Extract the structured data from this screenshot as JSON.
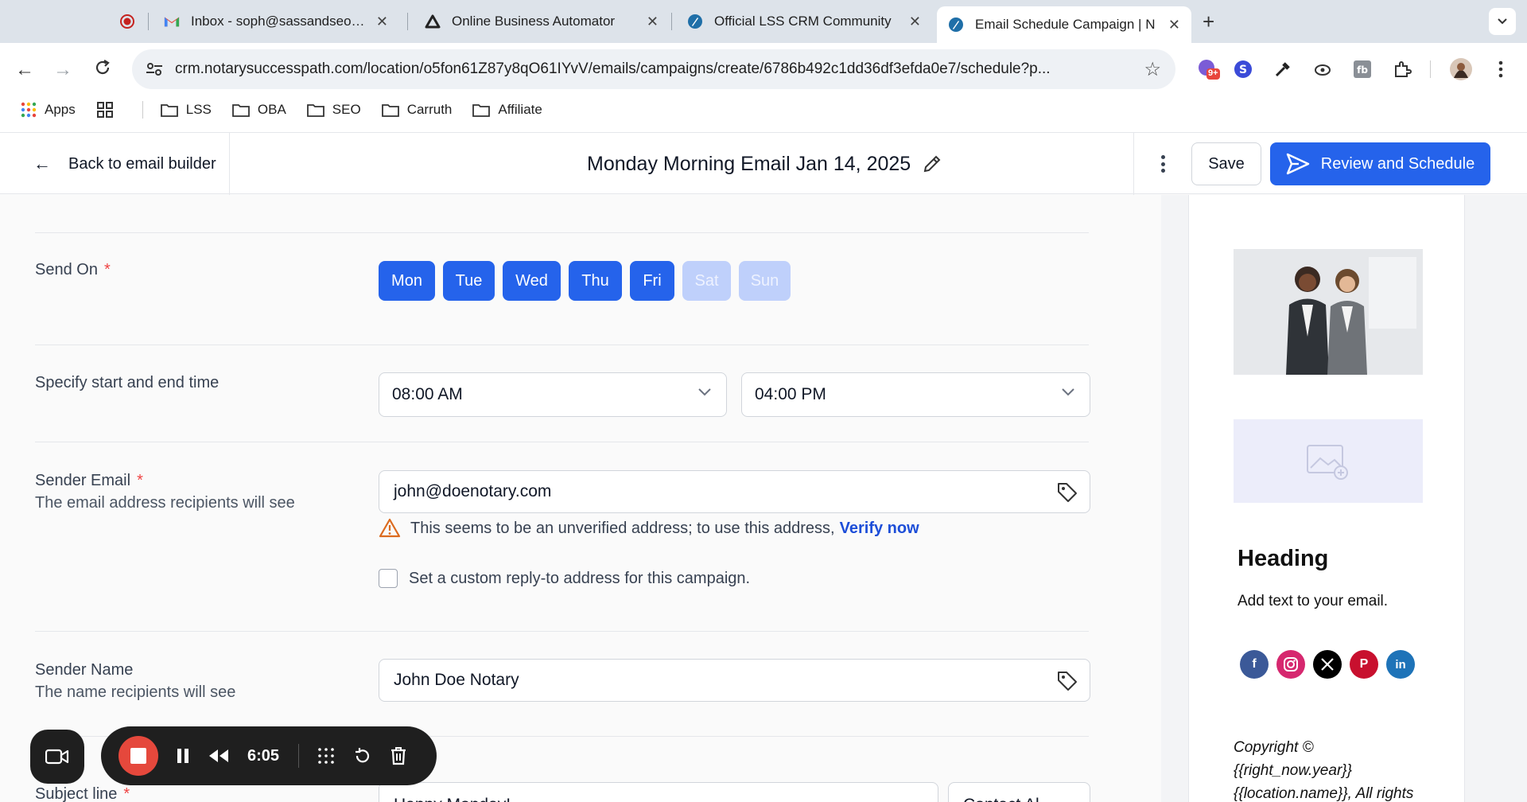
{
  "browser": {
    "tabs": [
      {
        "title": "",
        "icon": "record-icon"
      },
      {
        "title": "Inbox - soph@sassandseo.com",
        "icon": "gmail-icon"
      },
      {
        "title": "Online Business Automator",
        "icon": "triangle-logo-icon"
      },
      {
        "title": "Official LSS CRM Community",
        "icon": "compass-icon"
      },
      {
        "title": "Email Schedule Campaign | N",
        "icon": "compass-icon",
        "active": true
      }
    ],
    "url": "crm.notarysuccesspath.com/location/o5fon61Z87y8qO61IYvV/emails/campaigns/create/6786b492c1dd36df3efda0e7/schedule?p...",
    "extension_badge": "9+",
    "bookmarks": [
      "Apps",
      "LSS",
      "OBA",
      "SEO",
      "Carruth",
      "Affiliate"
    ]
  },
  "header": {
    "back_label": "Back to email builder",
    "title": "Monday Morning Email Jan 14, 2025",
    "save_label": "Save",
    "review_label": "Review and Schedule"
  },
  "form": {
    "send_on": {
      "label": "Send On",
      "required": "*",
      "days": [
        {
          "label": "Mon",
          "selected": true
        },
        {
          "label": "Tue",
          "selected": true
        },
        {
          "label": "Wed",
          "selected": true
        },
        {
          "label": "Thu",
          "selected": true
        },
        {
          "label": "Fri",
          "selected": true
        },
        {
          "label": "Sat",
          "selected": false
        },
        {
          "label": "Sun",
          "selected": false
        }
      ]
    },
    "time": {
      "label": "Specify start and end time",
      "start": "08:00 AM",
      "end": "04:00 PM"
    },
    "sender_email": {
      "label": "Sender Email",
      "required": "*",
      "sublabel": "The email address recipients will see",
      "value": "john@doenotary.com",
      "warning": "This seems to be an unverified address; to use this address,",
      "verify_link": "Verify now",
      "reply_to_checkbox": "Set a custom reply-to address for this campaign."
    },
    "sender_name": {
      "label": "Sender Name",
      "sublabel": "The name recipients will see",
      "value": "John Doe Notary"
    },
    "subject": {
      "label": "Subject line",
      "required": "*",
      "value": "Happy Monday!",
      "contact_button": "Contact Al"
    }
  },
  "preview": {
    "heading": "Heading",
    "text": "Add text to your email.",
    "socials": [
      "facebook",
      "instagram",
      "x",
      "pinterest",
      "linkedin"
    ],
    "copyright": [
      "Copyright ©",
      "{{right_now.year}}",
      "{{location.name}}, All rights"
    ]
  },
  "recorder": {
    "time": "6:05"
  },
  "colors": {
    "primary": "#2563eb",
    "primary_disabled": "#bfd0fb",
    "required": "#ef4444",
    "warning": "#dc6b1f",
    "link": "#1d4ed8",
    "record": "#e5483c"
  }
}
